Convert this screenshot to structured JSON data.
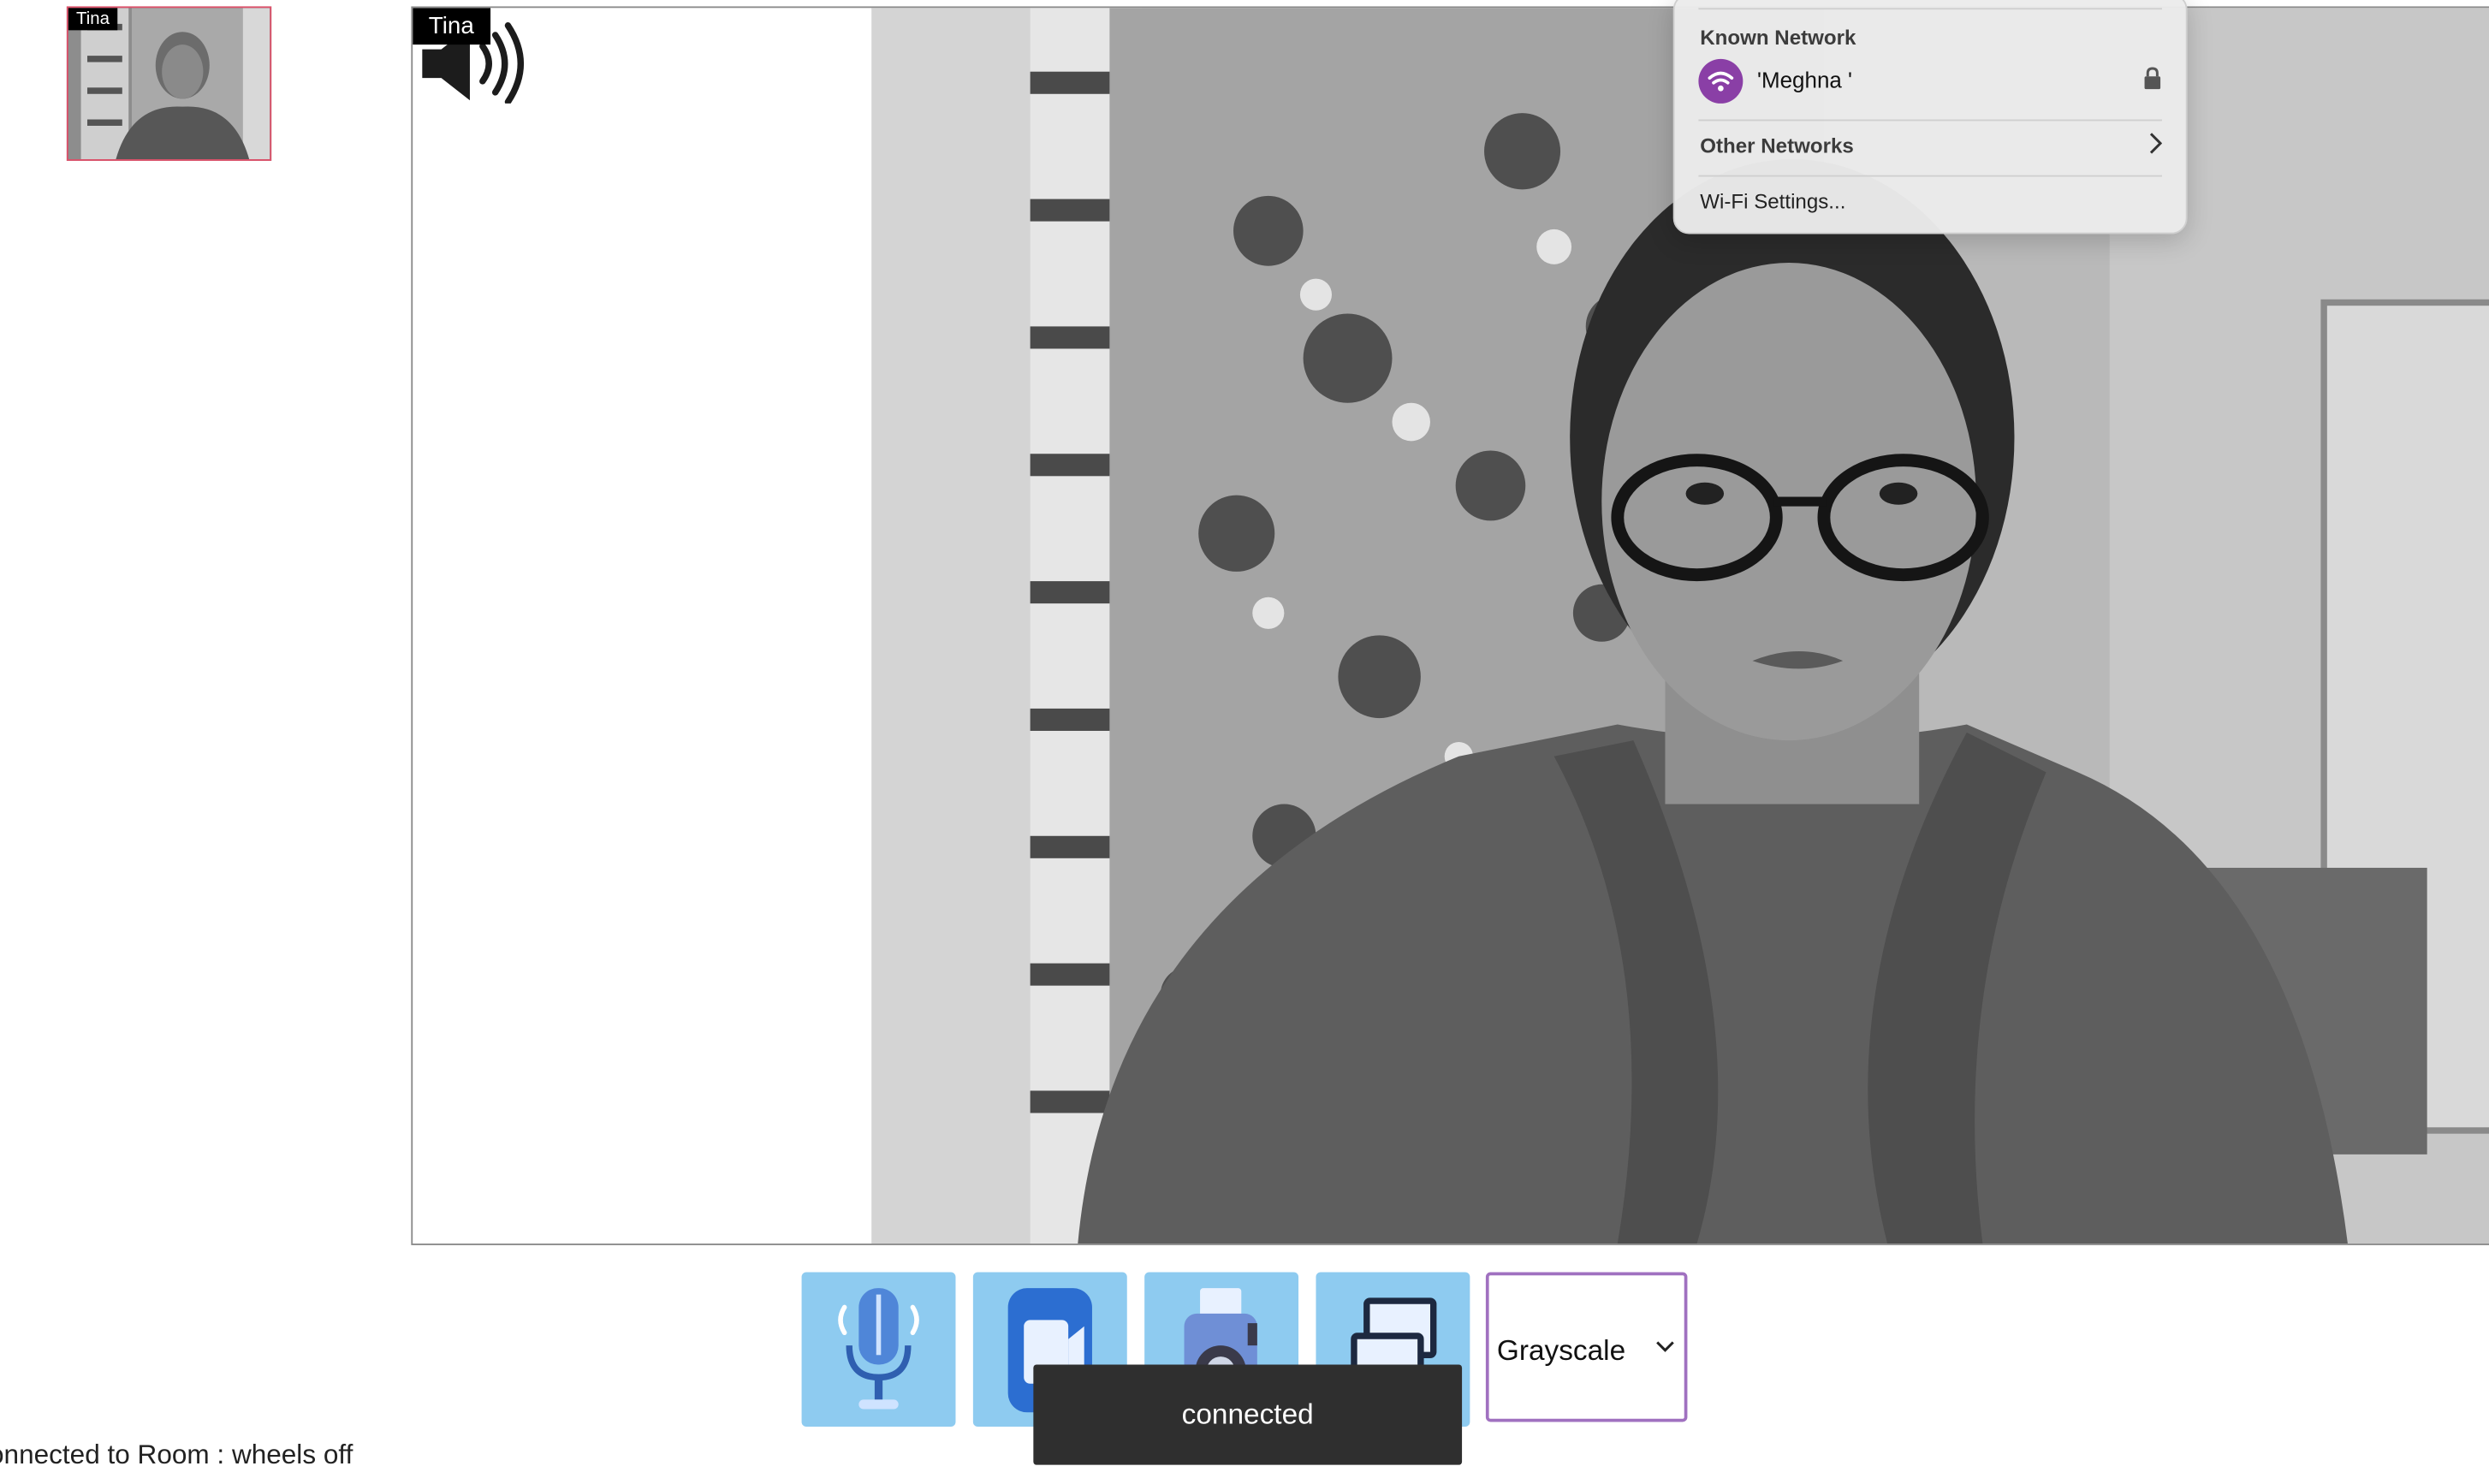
{
  "thumbnail": {
    "participant_name": "Tina"
  },
  "main_video": {
    "participant_name": "Tina"
  },
  "controls": {
    "microphone_icon": "microphone-icon",
    "video_icon": "video-camera-icon",
    "camera_icon": "photo-camera-icon",
    "screen_share_icon": "screen-share-icon",
    "filter_value": "Grayscale"
  },
  "toast": {
    "message": "connected"
  },
  "status": {
    "text": "onnected to Room : wheels off"
  },
  "wifi_menu": {
    "section_label": "Known Network",
    "network_name": "'Meghna '",
    "other_networks_label": "Other Networks",
    "settings_label": "Wi-Fi Settings..."
  },
  "colors": {
    "button_bg": "#8ecbf0",
    "select_border": "#a071c0",
    "thumbnail_border": "#e0506a",
    "wifi_accent": "#8a3fa6"
  }
}
